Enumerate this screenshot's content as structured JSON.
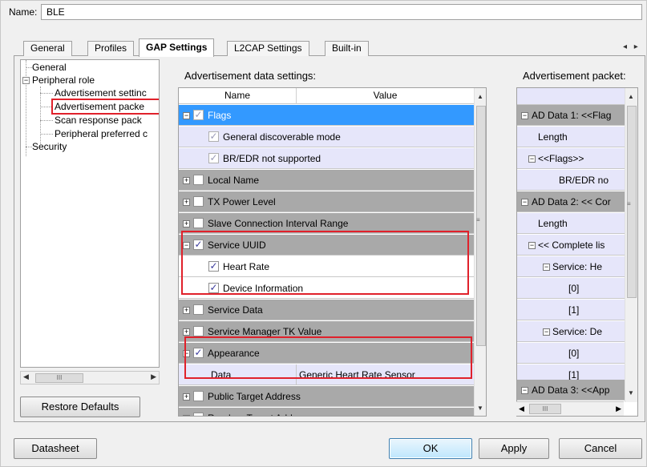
{
  "name_row": {
    "label": "Name:",
    "value": "BLE"
  },
  "tabs": [
    "General",
    "Profiles",
    "GAP Settings",
    "L2CAP Settings",
    "Built-in"
  ],
  "tab_scroll": "◂ ▸",
  "tree": {
    "items": [
      "General",
      "Peripheral role",
      "Advertisement settinc",
      "Advertisement packe",
      "Scan response pack",
      "Peripheral preferred c",
      "Security"
    ]
  },
  "tree_hscroll_grip": "III",
  "buttons": {
    "restore_defaults": "Restore Defaults",
    "datasheet": "Datasheet",
    "ok": "OK",
    "apply": "Apply",
    "cancel": "Cancel"
  },
  "adv_data": {
    "title": "Advertisement data settings:",
    "columns": [
      "Name",
      "Value"
    ],
    "rows": [
      {
        "name": "Flags",
        "value": ""
      },
      {
        "name": "General discoverable mode",
        "value": ""
      },
      {
        "name": "BR/EDR not supported",
        "value": ""
      },
      {
        "name": "Local Name",
        "value": ""
      },
      {
        "name": "TX Power Level",
        "value": ""
      },
      {
        "name": "Slave Connection Interval Range",
        "value": ""
      },
      {
        "name": "Service UUID",
        "value": ""
      },
      {
        "name": "Heart Rate",
        "value": ""
      },
      {
        "name": "Device Information",
        "value": ""
      },
      {
        "name": "Service Data",
        "value": ""
      },
      {
        "name": "Service Manager TK Value",
        "value": ""
      },
      {
        "name": "Appearance",
        "value": ""
      },
      {
        "name": "Data",
        "value": "Generic Heart Rate Sensor"
      },
      {
        "name": "Public Target Address",
        "value": ""
      },
      {
        "name": "Random Target Address",
        "value": ""
      }
    ]
  },
  "adv_packet": {
    "title": "Advertisement packet:",
    "rows": [
      "AD Data 1: <<Flag",
      "Length",
      "<<Flags>>",
      "BR/EDR no",
      "AD Data 2: << Cor",
      "Length",
      "<< Complete lis",
      "Service: He",
      "[0]",
      "[1]",
      "Service: De",
      "[0]",
      "[1]",
      "AD Data 3: <<App"
    ]
  },
  "packet_hscroll_grip": "III",
  "colors": {
    "selected": "#3399ff",
    "highlight": "#e0212b",
    "grey_row": "#a9a9a9",
    "lavender_row": "#e6e6fa"
  }
}
